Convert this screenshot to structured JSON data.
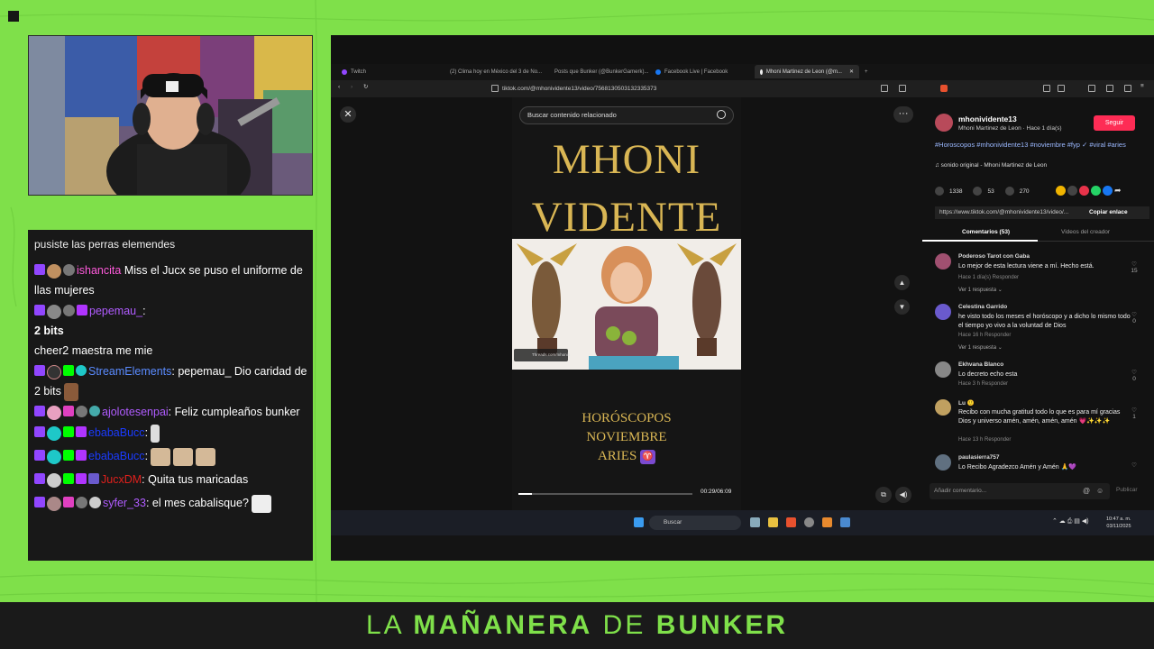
{
  "overlay": {
    "banner": {
      "part1": "LA",
      "part2": "MAÑANERA",
      "part3": "DE",
      "part4": "BUNKER"
    }
  },
  "chat": {
    "cutoff_line": "pusiste las perras elemendes",
    "messages": [
      {
        "user": "ishancita",
        "user_color": "#ff5adb",
        "text": " Miss el Jucx se puso el uniforme de llas mujeres"
      },
      {
        "user": "pepemau_",
        "user_color": "#b05cff",
        "text": ":",
        "extra_bold": "2 bits",
        "extra": "cheer2 maestra me mie"
      },
      {
        "user": "StreamElements",
        "user_color": "#5a8bff",
        "text": ": pepemau_ Dio caridad de 2 bits"
      },
      {
        "user": "ajolotesenpai",
        "user_color": "#b05cff",
        "text": ": Feliz cumpleaños bunker"
      },
      {
        "user": "ebabaBucc",
        "user_color": "#1a3bff",
        "text": ":"
      },
      {
        "user": "ebabaBucc",
        "user_color": "#1a3bff",
        "text": ":"
      },
      {
        "user": "JucxDM",
        "user_color": "#e0201c",
        "text": ": Quita tus maricadas"
      },
      {
        "user": "syfer_33",
        "user_color": "#b05cff",
        "text": ": el mes cabalisque?"
      }
    ]
  },
  "browser": {
    "tabs": [
      {
        "label": "Twitch",
        "color": "#9146ff"
      },
      {
        "label": "(2) Clima hoy en México del 3 de No...",
        "color": "#ff0000"
      },
      {
        "label": "Posts que Bunker (@BunkerGamerk)...",
        "color": "#ffffff"
      },
      {
        "label": "Facebook Live | Facebook",
        "color": "#1877f2"
      },
      {
        "label": "Mhoni Martinez de Leon (@m...",
        "color": "#eeeeee"
      }
    ],
    "url": "tiktok.com/@mhonividente13/video/7568130503132335373"
  },
  "video": {
    "search_placeholder": "Buscar contenido relacionado",
    "title_line1": "MHONI",
    "title_line2": "VIDENTE",
    "thumb_link": "Threads.com/mhoni1",
    "subtitle_line1": "HORÓSCOPOS",
    "subtitle_line2": "NOVIEMBRE",
    "subtitle_line3": "ARIES",
    "aries_glyph": "♈",
    "progress": 0.08,
    "time": "00:29/06:09"
  },
  "creator": {
    "handle": "mhonividente13",
    "name_time": "Mhoni Martinez de Leon · Hace 1 día(s)",
    "follow_label": "Seguir",
    "tags": "#Horoscopos #mhonividente13 #noviembre #fyp ✓ #viral #aries",
    "sound": "♫  sonido original - Mhoni Martinez de Leon",
    "likes": "1338",
    "comments_count": "53",
    "saves": "270",
    "link": "https://www.tiktok.com/@mhonividente13/video/...",
    "copy_label": "Copiar enlace",
    "tab_comments": "Comentarios (53)",
    "tab_creator": "Videos del creador",
    "add_comment_placeholder": "Añadir comentario...",
    "publish_label": "Publicar"
  },
  "comments": [
    {
      "user": "Poderoso Tarot con Gaba",
      "text": "Lo mejor de esta lectura viene a mí. Hecho está.",
      "meta": "Hace 1 día(s)     Responder",
      "replies": "Ver 1 respuesta ⌄",
      "likes": "15",
      "avatar": "#a05070"
    },
    {
      "user": "Celestina Garrido",
      "text": "he visto todo los meses el horóscopo y a dicho lo mismo todo el tiempo yo vivo a la voluntad de Dios",
      "meta": "Hace 16 h     Responder",
      "replies": "Ver 1 respuesta ⌄",
      "likes": "0",
      "avatar": "#6a5acd"
    },
    {
      "user": "Ekhvana Blanco",
      "text": "Lo decreto echo esta",
      "meta": "Hace 3 h     Responder",
      "replies": "",
      "likes": "0",
      "avatar": "#888888"
    },
    {
      "user": "Lu 🙂",
      "text": "Recibo con mucha gratitud todo lo que es para mí gracias Dios y universo amén, amén, amén, amén 💗✨✨✨",
      "meta": "Hace 13 h     Responder",
      "replies": "",
      "likes": "1",
      "avatar": "#c0a060"
    },
    {
      "user": "paulasierra757",
      "text": "Lo Recibo Agradezco Amén y Amén 🙏💜",
      "meta": "",
      "replies": "",
      "likes": "",
      "avatar": "#607080"
    }
  ],
  "taskbar": {
    "search_label": "Buscar",
    "time": "10:47 a. m.",
    "date": "03/11/2025"
  }
}
